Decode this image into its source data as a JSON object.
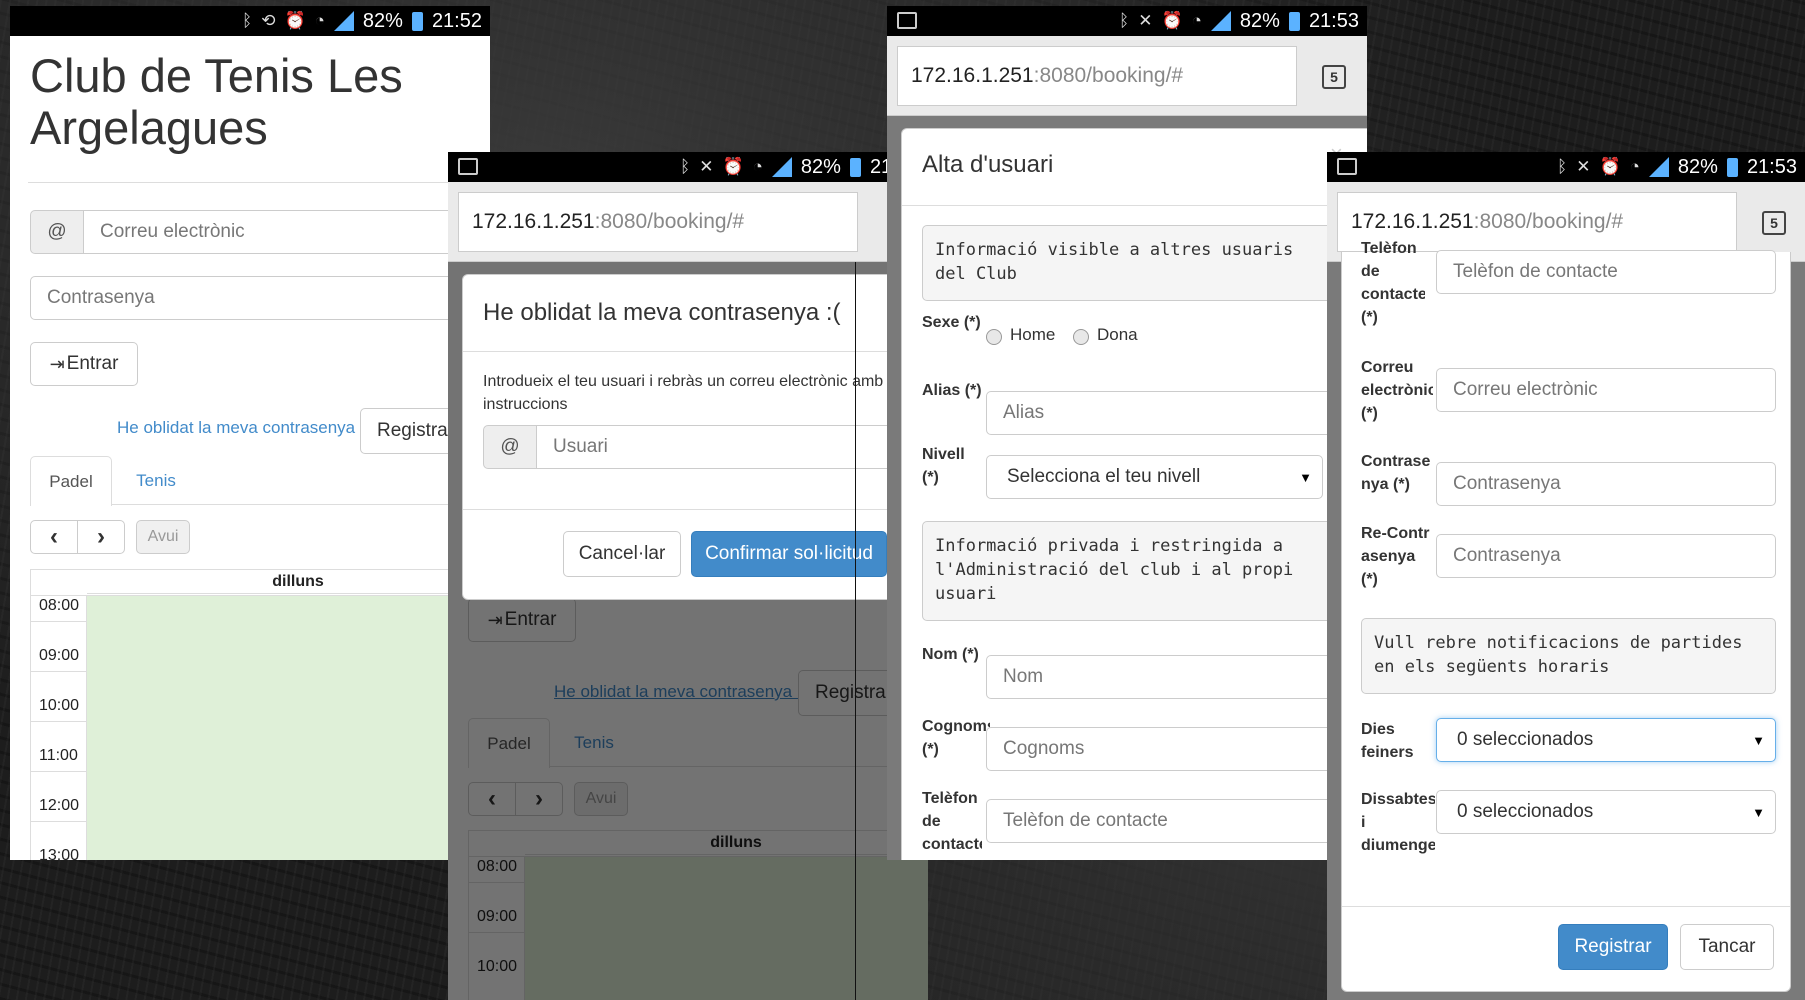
{
  "status": {
    "battery": "82%",
    "time1": "21:52",
    "time2": "21:53"
  },
  "url": {
    "host": "172.16.1.251",
    "path": ":8080/booking/#",
    "tabs": "5"
  },
  "login": {
    "title": "Club de Tenis Les Argelagues",
    "email_addon": "@",
    "email_placeholder": "Correu electrònic",
    "password_placeholder": "Contrasenya",
    "enter": "Entrar",
    "forgot": "He oblidat la meva contrasenya :(",
    "register": "Registra",
    "tabs": [
      "Padel",
      "Tenis"
    ],
    "prev": "‹",
    "next": "›",
    "today": "Avui",
    "day": "dilluns",
    "times": [
      "08:00",
      "09:00",
      "10:00",
      "11:00",
      "12:00",
      "13:00"
    ]
  },
  "forgot_modal": {
    "title": "He oblidat la meva contrasenya :(",
    "close": "×",
    "text": "Introdueix el teu usuari i rebràs un correu electrònic amb les instruccions",
    "user_addon": "@",
    "user_placeholder": "Usuari",
    "cancel": "Cancel·lar",
    "confirm": "Confirmar sol·licitud"
  },
  "register_modal": {
    "title": "Alta d'usuari",
    "close": "×",
    "public_info": "Informació visible a altres usuaris del Club",
    "sex_label": "Sexe (*)",
    "sex_home": "Home",
    "sex_dona": "Dona",
    "alias_label": "Alias (*)",
    "alias_placeholder": "Alias",
    "level_label": "Nivell (*)",
    "level_value": "Selecciona el teu nivell",
    "private_info": "Informació privada i restringida a l'Administració del club i al propi usuari",
    "name_label": "Nom (*)",
    "name_placeholder": "Nom",
    "surname_label": "Cognoms (*)",
    "surname_placeholder": "Cognoms",
    "phone_label": "Telèfon de contacte (*)",
    "phone_placeholder": "Telèfon de contacte"
  },
  "register_modal2": {
    "phone_label": "Telèfon de contacte (*)",
    "phone_placeholder": "Telèfon de contacte",
    "email_label": "Correu electrònic (*)",
    "email_placeholder": "Correu electrònic",
    "pass_label": "Contrasenya (*)",
    "pass_placeholder": "Contrasenya",
    "repass_label": "Re-Contrasenya (*)",
    "repass_placeholder": "Contrasenya",
    "notif_info": "Vull rebre notificacions de partides en els següents horaris",
    "weekdays_label": "Dies feiners",
    "weekdays_value": "0 seleccionados",
    "weekend_label": "Dissabtes i diumenges",
    "weekend_value": "0 seleccionados",
    "register": "Registrar",
    "close_btn": "Tancar"
  },
  "colors": {
    "primary": "#428bca",
    "calendar_green": "#dff0d8",
    "status_blue": "#5bb2ff"
  }
}
